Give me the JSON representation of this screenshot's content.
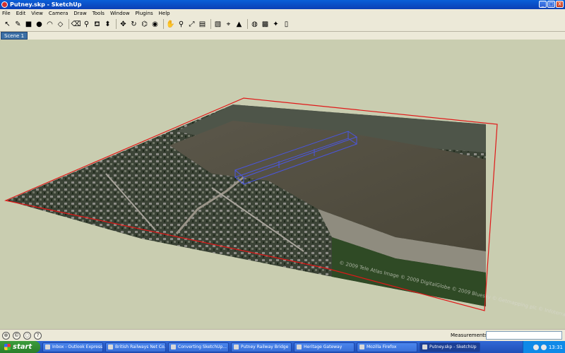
{
  "window": {
    "title": "Putney.skp - SketchUp",
    "controls": {
      "minimize": "_",
      "maximize": "□",
      "close": "X"
    }
  },
  "menu": [
    "File",
    "Edit",
    "View",
    "Camera",
    "Draw",
    "Tools",
    "Window",
    "Plugins",
    "Help"
  ],
  "toolbar": {
    "tools": [
      {
        "name": "select-tool",
        "glyph": "↖"
      },
      {
        "name": "pencil-tool",
        "glyph": "✎"
      },
      {
        "name": "rectangle-tool",
        "glyph": "■"
      },
      {
        "name": "circle-tool",
        "glyph": "●"
      },
      {
        "name": "arc-tool",
        "glyph": "◠"
      },
      {
        "name": "make-component-tool",
        "glyph": "◇"
      },
      {
        "name": "eraser-tool",
        "glyph": "⌫"
      },
      {
        "name": "tape-measure-tool",
        "glyph": "⚲"
      },
      {
        "name": "paint-bucket-tool",
        "glyph": "⛾"
      },
      {
        "name": "push-pull-tool",
        "glyph": "⬍"
      },
      {
        "name": "move-tool",
        "glyph": "✥"
      },
      {
        "name": "rotate-tool",
        "glyph": "↻"
      },
      {
        "name": "offset-tool",
        "glyph": "⌬"
      },
      {
        "name": "orbit-tool",
        "glyph": "◉"
      },
      {
        "name": "pan-tool",
        "glyph": "✋"
      },
      {
        "name": "zoom-tool",
        "glyph": "⚲"
      },
      {
        "name": "zoom-extents-tool",
        "glyph": "⤢"
      },
      {
        "name": "3d-warehouse-tool",
        "glyph": "▤"
      },
      {
        "name": "share-model-tool",
        "glyph": "▧"
      },
      {
        "name": "get-location-tool",
        "glyph": "⌖"
      },
      {
        "name": "toggle-terrain-tool",
        "glyph": "▲"
      },
      {
        "name": "google-earth-tool",
        "glyph": "◍"
      },
      {
        "name": "photo-textures-tool",
        "glyph": "▩"
      },
      {
        "name": "extension-warehouse-tool",
        "glyph": "✦"
      },
      {
        "name": "help-tool",
        "glyph": "▯"
      }
    ]
  },
  "scene": {
    "tab_label": "Scene 1"
  },
  "viewport": {
    "watermark": "© 2009 Tele Atlas  Image © 2009 DigitalGlobe  © 2009 Bluesky  © Getmapping plc  © Infoterra Ltd & Bluesky"
  },
  "statusbar": {
    "measurements_label": "Measurements",
    "measurements_value": ""
  },
  "taskbar": {
    "start_label": "start",
    "tasks": [
      {
        "label": "Inbox - Outlook Express",
        "active": false
      },
      {
        "label": "British Railways Net Co...",
        "active": false
      },
      {
        "label": "Converting SketchUp...",
        "active": false
      },
      {
        "label": "Putney Railway Bridge",
        "active": false
      },
      {
        "label": "Heritage Gateway",
        "active": false
      },
      {
        "label": "Mozilla Firefox",
        "active": false
      },
      {
        "label": "Putney.skp - SketchUp",
        "active": true
      }
    ],
    "clock": "13:31"
  }
}
